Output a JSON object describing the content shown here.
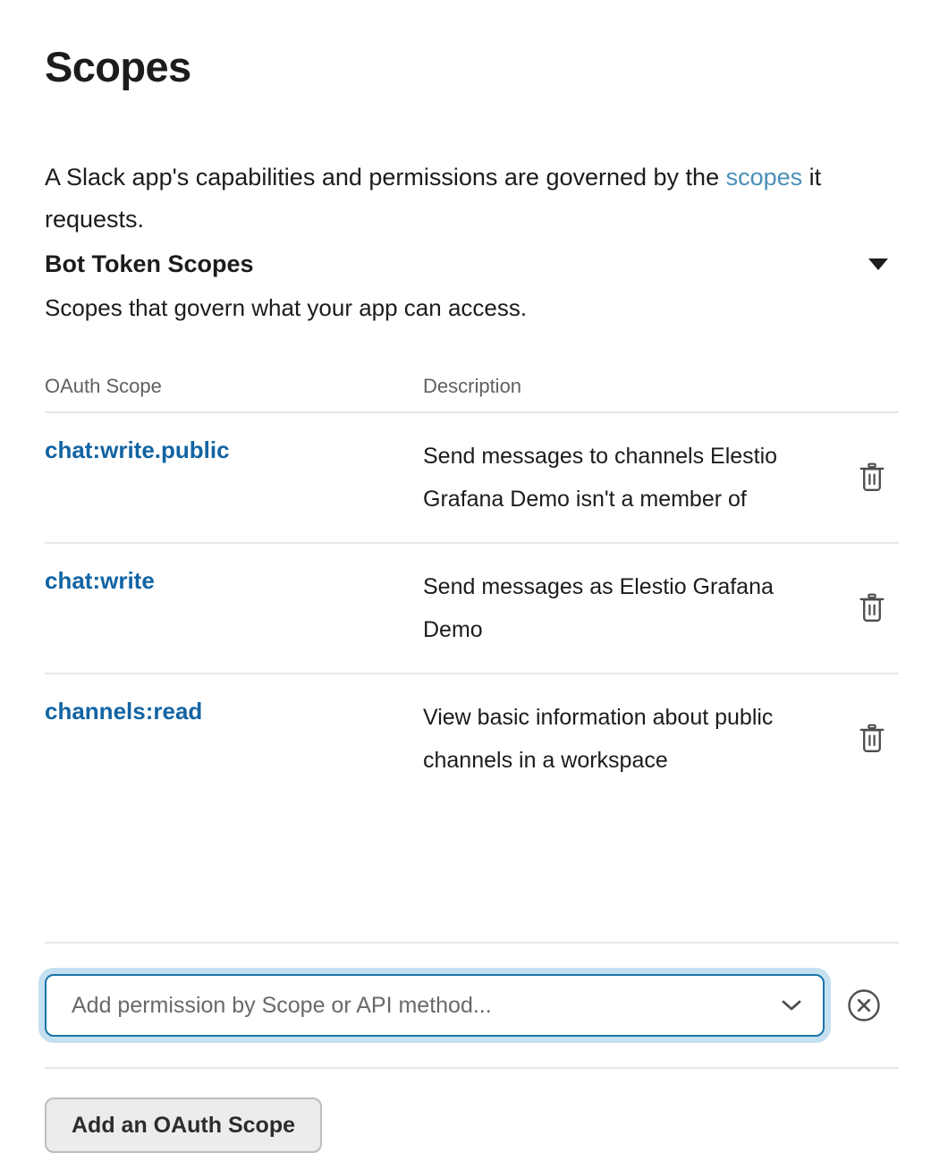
{
  "page": {
    "title": "Scopes",
    "intro_prefix": "A Slack app's capabilities and permissions are governed by the ",
    "intro_link": "scopes",
    "intro_suffix": " it requests."
  },
  "section": {
    "title": "Bot Token Scopes",
    "subtitle": "Scopes that govern what your app can access.",
    "collapse_icon": "caret-down-icon"
  },
  "table": {
    "headers": {
      "scope": "OAuth Scope",
      "description": "Description"
    },
    "rows": [
      {
        "scope": "chat:write.public",
        "description": "Send messages to channels Elestio Grafana Demo isn't a member of",
        "delete_icon": "trash-icon"
      },
      {
        "scope": "chat:write",
        "description": "Send messages as Elestio Grafana Demo",
        "delete_icon": "trash-icon"
      },
      {
        "scope": "channels:read",
        "description": "View basic information about public channels in a workspace",
        "delete_icon": "trash-icon"
      }
    ]
  },
  "combobox": {
    "placeholder": "Add permission by Scope or API method...",
    "value": "",
    "caret_icon": "chevron-down-icon",
    "clear_icon": "close-circle-icon"
  },
  "footer": {
    "add_scope_label": "Add an OAuth Scope"
  },
  "colors": {
    "link_blue": "#1264a3",
    "link_soft_blue": "#4a8fb8",
    "focus_border": "#1b74a8",
    "focus_ring": "#c5e0f0",
    "muted_text": "#616061",
    "divider": "#e8e8e8",
    "button_bg": "#ececec"
  }
}
